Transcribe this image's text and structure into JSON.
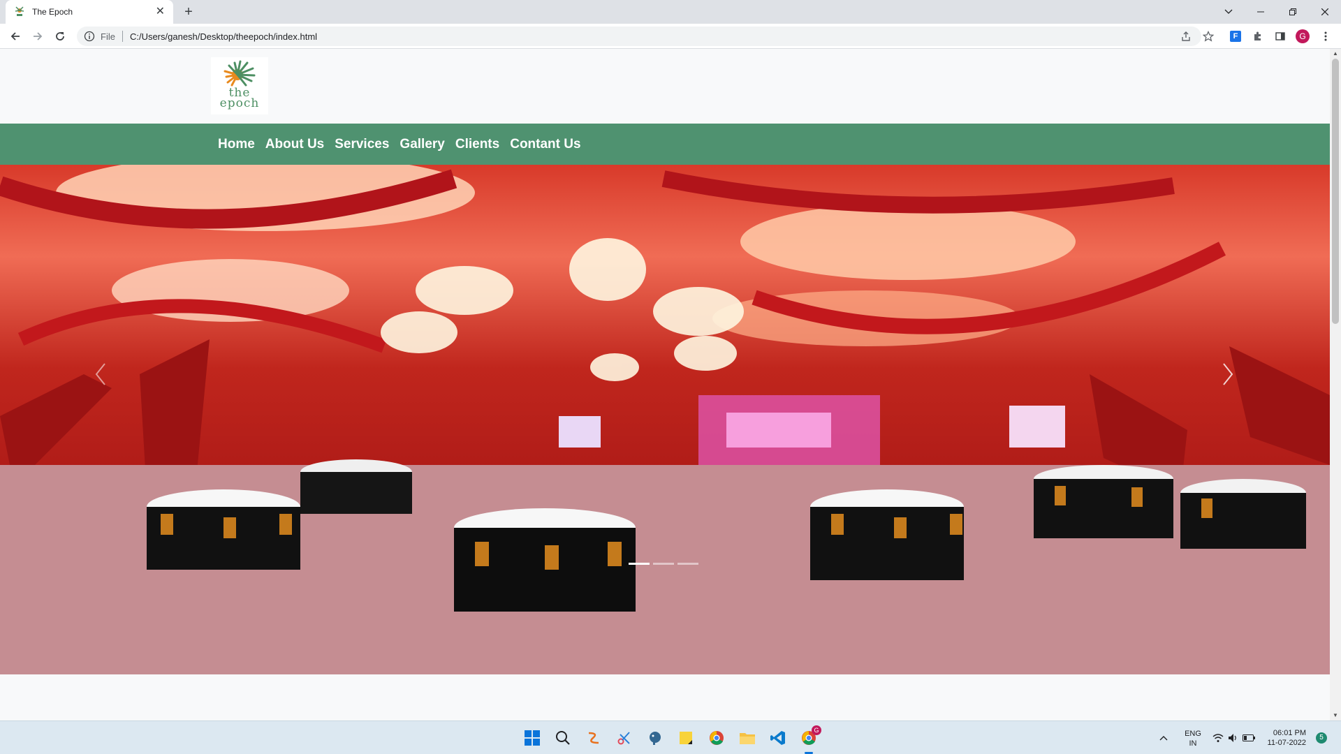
{
  "browser": {
    "tab_title": "The Epoch",
    "tab_close": "✕",
    "new_tab": "+",
    "url_scheme": "File",
    "url": "C:/Users/ganesh/Desktop/theepoch/index.html",
    "profile_initial": "G",
    "extension_letter": "F"
  },
  "site": {
    "logo_line1": "the",
    "logo_line2": "epoch",
    "nav": [
      "Home",
      "About Us",
      "Services",
      "Gallery",
      "Clients",
      "Contant Us"
    ],
    "carousel": {
      "slides_count": 3,
      "active_slide": 1
    }
  },
  "taskbar": {
    "lang_line1": "ENG",
    "lang_line2": "IN",
    "time": "06:01 PM",
    "date": "11-07-2022",
    "notification_count": "5",
    "chrome_badge": "G"
  },
  "colors": {
    "nav_bg": "#4f9270",
    "logo_green": "#4d8f63",
    "logo_orange": "#e88a1e",
    "profile": "#c2185b"
  }
}
